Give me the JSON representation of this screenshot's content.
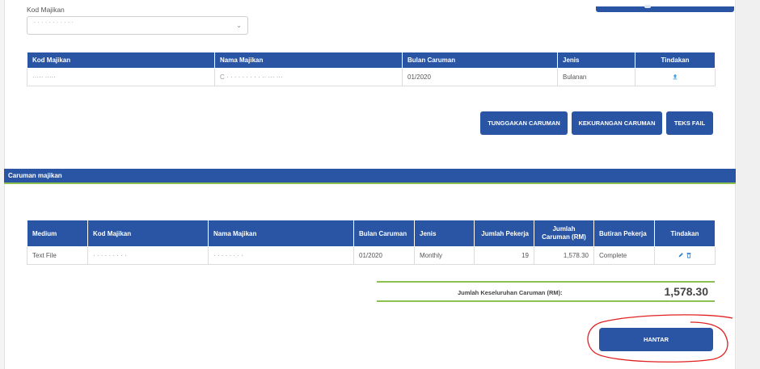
{
  "form": {
    "kod_label": "Kod Majikan",
    "kod_value": "· · · · · · · · · · ·"
  },
  "table1": {
    "headers": [
      "Kod Majikan",
      "Nama Majikan",
      "Bulan Caruman",
      "Jenis",
      "Tindakan"
    ],
    "row": {
      "kod": "·····  ·····",
      "nama": "C ·  · · · · · · · ·  ·· ··· ···",
      "bulan": "01/2020",
      "jenis": "Bulanan"
    }
  },
  "buttons": {
    "tunggakan": "TUNGGAKAN CARUMAN",
    "kekurangan": "KEKURANGAN CARUMAN",
    "teks_fail": "TEKS FAIL",
    "hantar": "HANTAR"
  },
  "section": {
    "title": "Caruman majikan"
  },
  "table2": {
    "headers": {
      "medium": "Medium",
      "kod": "Kod Majikan",
      "nama": "Nama Majikan",
      "bulan": "Bulan Caruman",
      "jenis": "Jenis",
      "pekerja": "Jumlah Pekerja",
      "caruman": "Jumlah Caruman (RM)",
      "butiran": "Butiran Pekerja",
      "tindakan": "Tindakan"
    },
    "row": {
      "medium": "Text File",
      "kod": "· · · · · · · · ·",
      "nama": "· · · · · ·  ·  ·",
      "bulan": "01/2020",
      "jenis": "Monthly",
      "pekerja": "19",
      "caruman": "1,578.30",
      "butiran": "Complete"
    }
  },
  "total": {
    "label": "Jumlah Keseluruhan Caruman (RM):",
    "value": "1,578.30"
  },
  "colors": {
    "primary": "#2a55a5",
    "accent_line": "#8cc152",
    "annotation": "#e02020"
  }
}
